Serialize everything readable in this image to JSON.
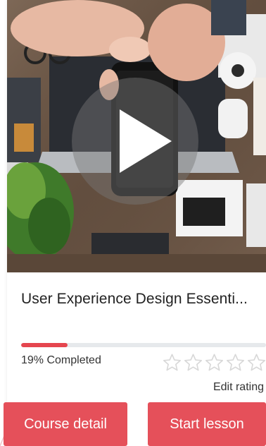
{
  "course": {
    "title": "User Experience Design Essenti...",
    "progress_label": "19% Completed",
    "progress_fraction": 0.19,
    "rating_stars_total": 5,
    "rating_stars_filled": 0,
    "edit_rating_label": "Edit rating"
  },
  "buttons": {
    "course_detail": "Course detail",
    "start_lesson": "Start lesson"
  },
  "colors": {
    "accent": "#e5505a",
    "progress_fill": "#e5464f",
    "progress_track": "#e6e9ec",
    "star_outline": "#d8d8d8"
  },
  "icons": {
    "play": "play-icon",
    "star": "star-outline-icon"
  }
}
